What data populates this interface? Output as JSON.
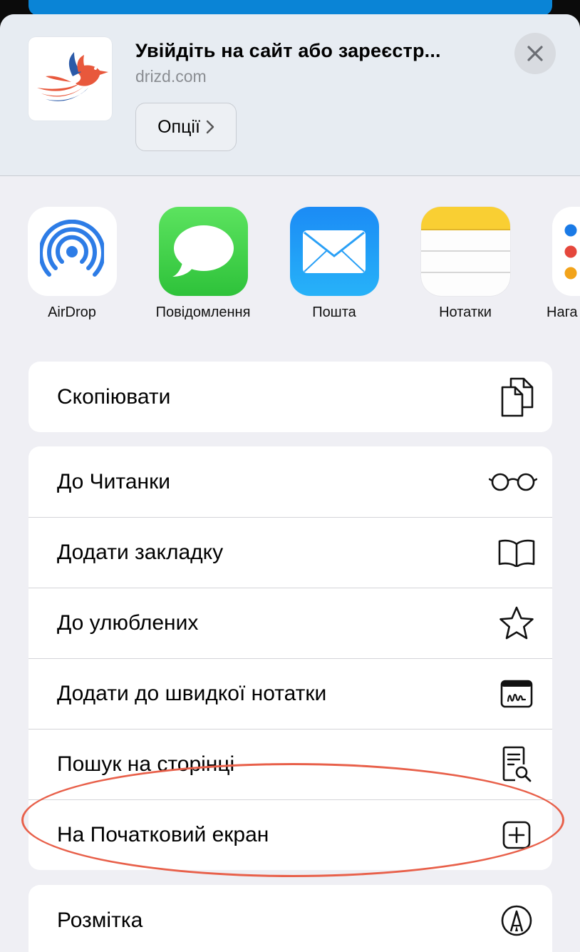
{
  "header": {
    "title": "Увійдіть на сайт або зареєстр...",
    "url": "drizd.com",
    "options_label": "Опції",
    "close_icon": "close-icon"
  },
  "apps": [
    {
      "label": "AirDrop",
      "icon": "airdrop-icon"
    },
    {
      "label": "Повідомлення",
      "icon": "messages-icon"
    },
    {
      "label": "Пошта",
      "icon": "mail-icon"
    },
    {
      "label": "Нотатки",
      "icon": "notes-icon"
    },
    {
      "label": "Нага",
      "icon": "reminders-icon"
    }
  ],
  "actions": {
    "copy": {
      "label": "Скопіювати",
      "icon": "copy-icon"
    },
    "reader": {
      "label": "До Читанки",
      "icon": "glasses-icon"
    },
    "bookmark": {
      "label": "Додати закладку",
      "icon": "book-icon"
    },
    "favorites": {
      "label": "До улюблених",
      "icon": "star-icon"
    },
    "quick_note": {
      "label": "Додати до швидкої нотатки",
      "icon": "quick-note-icon"
    },
    "find": {
      "label": "Пошук на сторінці",
      "icon": "find-on-page-icon"
    },
    "home_screen": {
      "label": "На Початковий екран",
      "icon": "add-square-icon"
    },
    "markup": {
      "label": "Розмітка",
      "icon": "markup-icon"
    }
  },
  "colors": {
    "highlight": "#e8604a",
    "accent_blue": "#0a84d6"
  }
}
